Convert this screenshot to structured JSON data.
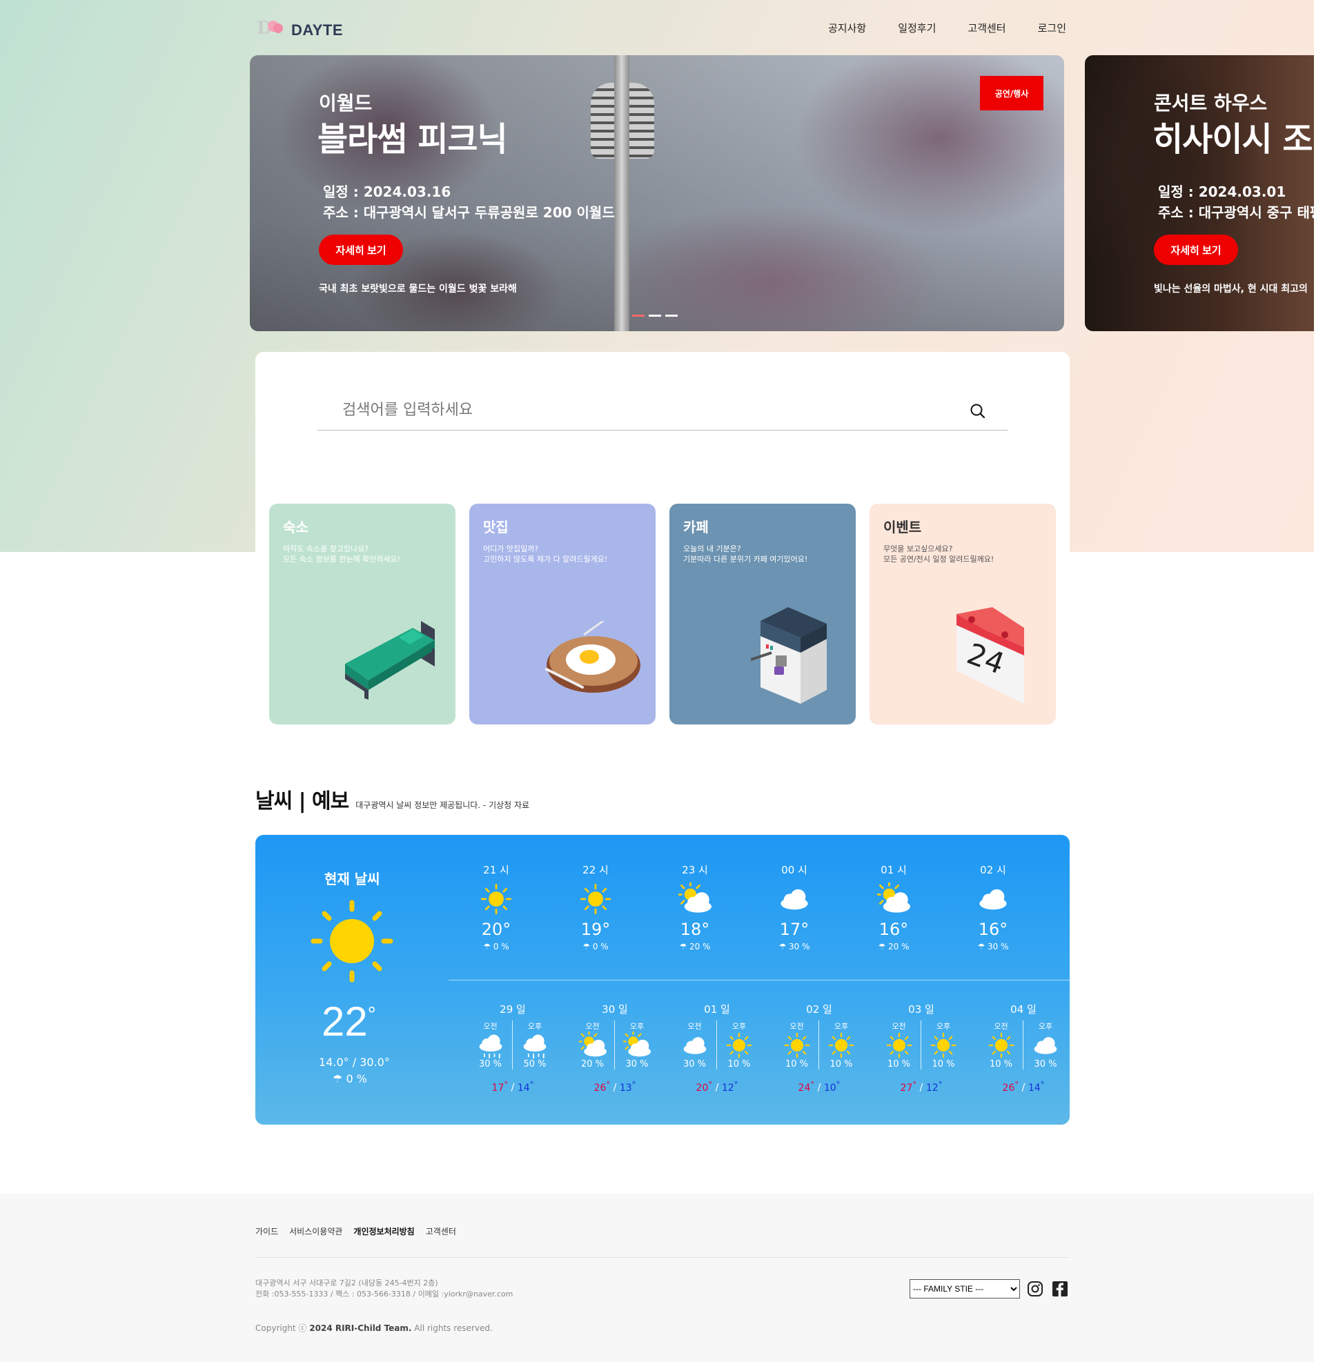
{
  "brand": {
    "name": "DAYTE"
  },
  "nav": [
    {
      "label": "공지사항"
    },
    {
      "label": "일정후기"
    },
    {
      "label": "고객센터"
    },
    {
      "label": "로그인"
    }
  ],
  "slides": [
    {
      "badge": "공연/행사",
      "pretitle": "이월드",
      "title": "블라썸 피크닉",
      "date": "일정 : 2024.03.16",
      "address": "주소 : 대구광역시 달서구 두류공원로 200 이월드",
      "button": "자세히 보기",
      "desc": "국내 최초 보랏빛으로 물드는 이월드 벚꽃 보라해"
    },
    {
      "pretitle": "콘서트 하우스",
      "title": "히사이시 조",
      "date": "일정 : 2024.03.01",
      "address": "주소 : 대구광역시 중구 태평",
      "button": "자세히 보기",
      "desc": "빛나는 선율의 마법사, 현 시대 최고의"
    }
  ],
  "search": {
    "placeholder": "검색어를 입력하세요"
  },
  "categories": [
    {
      "title": "숙소",
      "desc1": "아직도 숙소를 찾고있나요?",
      "desc2": "모든 숙소 정보를 한눈에 확인하세요!",
      "color": "#bfe2d0",
      "icon": "bed-icon"
    },
    {
      "title": "맛집",
      "desc1": "어디가 맛집일까?",
      "desc2": "고민하지 않도록 제가 다 알려드릴게요!",
      "color": "#a9b6ea",
      "icon": "fried-egg-plate-icon"
    },
    {
      "title": "카페",
      "desc1": "오늘의 내 기분은?",
      "desc2": "기분따라 다른 분위기 카페 여기있어요!",
      "color": "#6c93b1",
      "icon": "coffee-machine-icon"
    },
    {
      "title": "이벤트",
      "desc1": "무엇을 보고싶으세요?",
      "desc2": "모든 공연/전시 일정 알려드릴께요!",
      "color": "#fde6da",
      "icon": "calendar-icon"
    }
  ],
  "weather": {
    "title": "날씨 | 예보",
    "subtitle": "대구광역시 날씨 정보만 제공됩니다. - 기상청 자료",
    "current": {
      "label": "현재 날씨",
      "temp": "22",
      "unit": "°",
      "range": "14.0° / 30.0°",
      "rain": "0 %",
      "icon": "sun-icon"
    },
    "hourly": [
      {
        "time": "21 시",
        "temp": "20",
        "rain": "0 %",
        "icon": "sun"
      },
      {
        "time": "22 시",
        "temp": "19",
        "rain": "0 %",
        "icon": "sun"
      },
      {
        "time": "23 시",
        "temp": "18",
        "rain": "20 %",
        "icon": "partly"
      },
      {
        "time": "00 시",
        "temp": "17",
        "rain": "30 %",
        "icon": "cloud"
      },
      {
        "time": "01 시",
        "temp": "16",
        "rain": "20 %",
        "icon": "partly"
      },
      {
        "time": "02 시",
        "temp": "16",
        "rain": "30 %",
        "icon": "cloud"
      }
    ],
    "daily": [
      {
        "day": "29 일",
        "am_icon": "rain",
        "pm_icon": "rain",
        "am_rain": "30 %",
        "pm_rain": "50 %",
        "low": "17",
        "high": "14"
      },
      {
        "day": "30 일",
        "am_icon": "partly",
        "pm_icon": "partly",
        "am_rain": "20 %",
        "pm_rain": "30 %",
        "low": "26",
        "high": "13"
      },
      {
        "day": "01 일",
        "am_icon": "cloud",
        "pm_icon": "sun",
        "am_rain": "30 %",
        "pm_rain": "10 %",
        "low": "20",
        "high": "12"
      },
      {
        "day": "02 일",
        "am_icon": "sun",
        "pm_icon": "sun",
        "am_rain": "10 %",
        "pm_rain": "10 %",
        "low": "24",
        "high": "10"
      },
      {
        "day": "03 일",
        "am_icon": "sun",
        "pm_icon": "sun",
        "am_rain": "10 %",
        "pm_rain": "10 %",
        "low": "27",
        "high": "12"
      },
      {
        "day": "04 일",
        "am_icon": "sun",
        "pm_icon": "cloud",
        "am_rain": "10 %",
        "pm_rain": "30 %",
        "low": "26",
        "high": "14"
      }
    ],
    "am_label": "오전",
    "pm_label": "오후",
    "degree": "°"
  },
  "footer": {
    "links": [
      {
        "label": "가이드"
      },
      {
        "label": "서비스이용약관"
      },
      {
        "label": "개인정보처리방침"
      },
      {
        "label": "고객센터"
      }
    ],
    "address": "대구광역시 서구 서대구로 7길2 (내당동 245-4번지 2층)",
    "contact": "전화 :053-555-1333 / 팩스 : 053-566-3318 / 이메일 :yiorkr@naver.com",
    "copyright_pre": "Copyright ⓒ ",
    "copyright_team": "2024 RIRI-Child Team.",
    "copyright_post": " All rights reserved.",
    "family_site": "--- FAMILY STIE ---",
    "social": [
      "instagram-icon",
      "facebook-icon"
    ]
  }
}
